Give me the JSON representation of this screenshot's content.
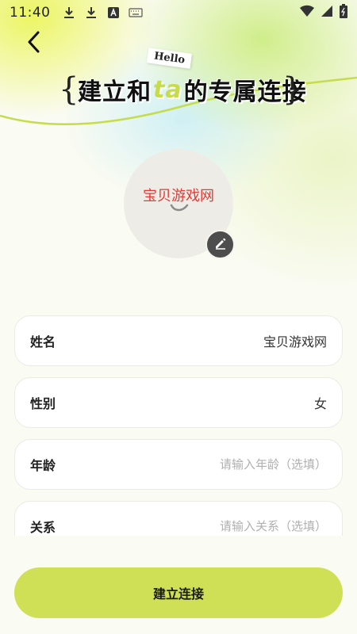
{
  "status_bar": {
    "time": "11:40",
    "icons": [
      "download-icon",
      "download-icon",
      "app-icon",
      "keyboard-icon"
    ],
    "right_icons": [
      "wifi-icon",
      "signal-icon",
      "battery-icon"
    ]
  },
  "header": {
    "hello_tag": "Hello",
    "brace_left": "{",
    "brace_right": "}",
    "title_part1": "建立和",
    "title_highlight": "ta",
    "title_part2": "的专属连接"
  },
  "avatar": {
    "name_text": "宝贝游戏网"
  },
  "form": {
    "fields": [
      {
        "label": "姓名",
        "value": "宝贝游戏网"
      },
      {
        "label": "性别",
        "value": "女"
      },
      {
        "label": "年龄",
        "value": "",
        "placeholder": "请输入年龄（选填）"
      },
      {
        "label": "关系",
        "value": "",
        "placeholder": "请输入关系（选填）"
      }
    ]
  },
  "submit": {
    "label": "建立连接"
  },
  "colors": {
    "accent": "#cfe057",
    "avatar_text": "#e53935",
    "edit_button": "#4d4d4d"
  }
}
